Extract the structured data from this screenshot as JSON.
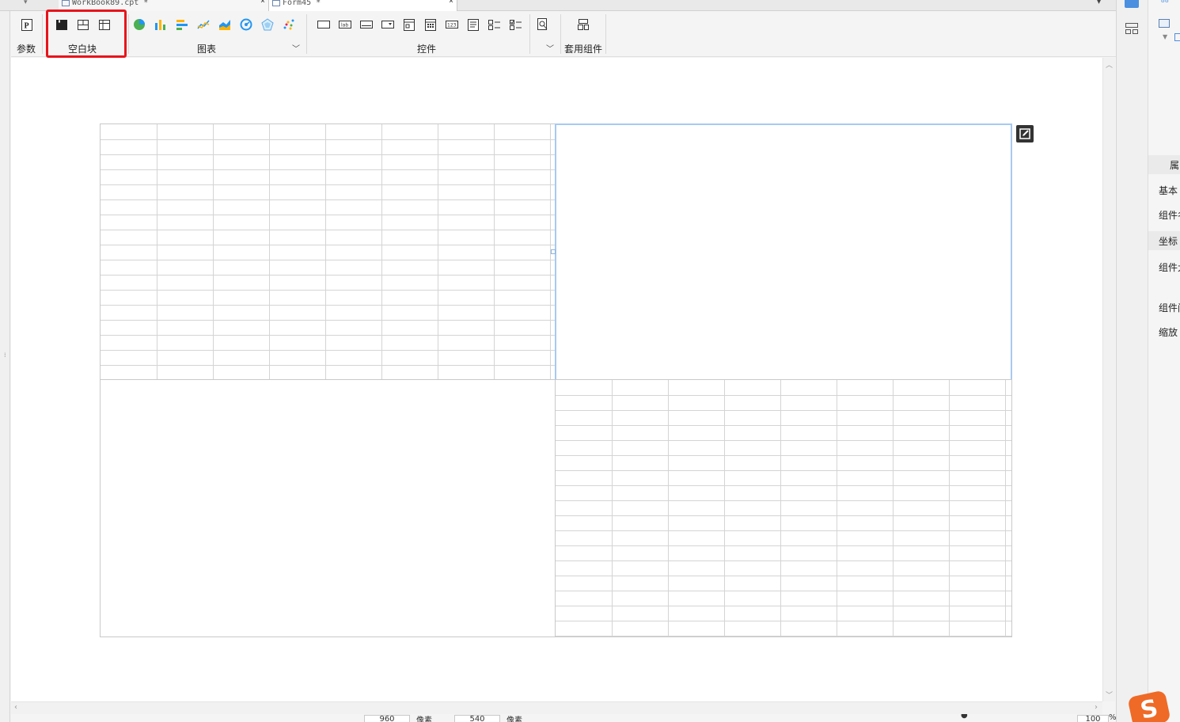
{
  "tabs": [
    {
      "label": "WorkBook89.cpt *",
      "close": "×"
    },
    {
      "label": "Form45 *",
      "close": "×"
    }
  ],
  "ribbon": {
    "param": {
      "label": "参数",
      "icon": "param-p-icon"
    },
    "blank_block": {
      "label": "空白块",
      "icons": [
        "blank-block-icon",
        "split-block-icon",
        "table-block-icon"
      ]
    },
    "chart": {
      "label": "图表",
      "icons": [
        "pie-chart-icon",
        "bar-chart-icon",
        "horizontal-bar-icon",
        "line-chart-icon",
        "area-chart-icon",
        "gauge-chart-icon",
        "radar-chart-icon",
        "scatter-chart-icon"
      ]
    },
    "controls": {
      "label": "控件",
      "icons": [
        "button-control-icon",
        "label-control-icon",
        "text-field-icon",
        "dropdown-control-icon",
        "date-control-icon",
        "calendar-control-icon",
        "number-control-icon",
        "textarea-control-icon",
        "checkbox-group-icon",
        "radio-group-icon",
        "preview-icon"
      ]
    },
    "template": {
      "label": "套用组件",
      "icon": "template-component-icon"
    },
    "highlight_color": "#e8141b"
  },
  "status": {
    "width_value": "960",
    "width_unit": "像素",
    "height_value": "540",
    "height_unit": "像素",
    "zoom": "100",
    "zoom_unit": "%"
  },
  "right_panel": {
    "tab_attr": "属",
    "items": [
      "基本",
      "组件名",
      "坐标",
      "组件大",
      "组件间",
      "缩放"
    ]
  },
  "colors": {
    "selection": "#a7c9f0",
    "grid_line": "#d4d4d4",
    "highlight": "#e8141b",
    "accent": "#4a8fe0"
  }
}
